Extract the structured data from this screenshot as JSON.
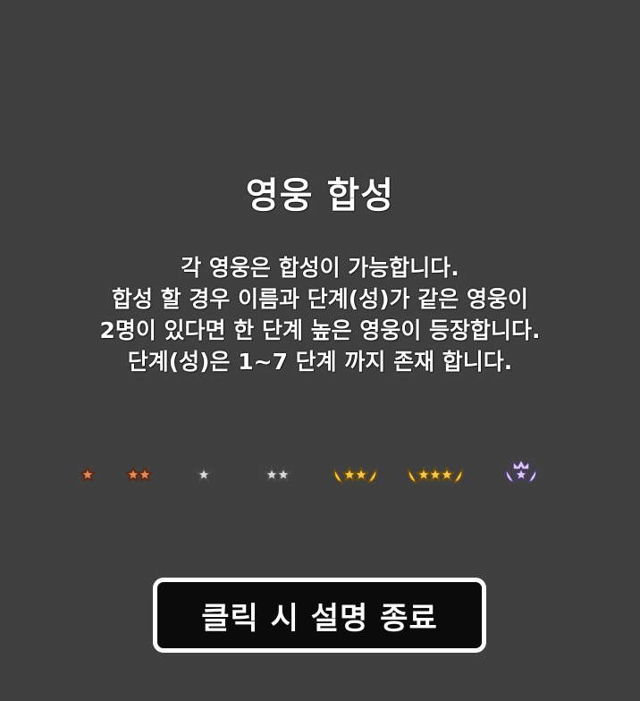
{
  "panel": {
    "title": "영웅 합성",
    "description_lines": [
      "각 영웅은 합성이 가능합니다.",
      "합성 할 경우 이름과 단계(성)가 같은 영웅이",
      "2명이 있다면 한 단계 높은 영웅이 등장합니다.",
      "단계(성)은 1~7 단계 까지 존재 합니다."
    ],
    "close_button_label": "클릭 시 설명 종료"
  },
  "star_tiers": [
    {
      "stars": 1,
      "tier": "bronze",
      "wreath": false,
      "crown": false
    },
    {
      "stars": 2,
      "tier": "bronze",
      "wreath": false,
      "crown": false
    },
    {
      "stars": 1,
      "tier": "silver",
      "wreath": false,
      "crown": false
    },
    {
      "stars": 2,
      "tier": "silver",
      "wreath": false,
      "crown": false
    },
    {
      "stars": 2,
      "tier": "gold",
      "wreath": true,
      "crown": false
    },
    {
      "stars": 3,
      "tier": "gold",
      "wreath": true,
      "crown": false
    },
    {
      "stars": 1,
      "tier": "purple",
      "wreath": true,
      "crown": true
    }
  ],
  "colors": {
    "background": "#404040",
    "text": "#ffffff",
    "button_bg": "#0b0b0b",
    "button_border": "#ffffff",
    "bronze_fill": "#e2895a",
    "bronze_outline": "#5a2a14",
    "silver_fill": "#d8d8d8",
    "silver_outline": "#4a4a4a",
    "gold_fill": "#f3c94a",
    "gold_outline": "#6b4a10",
    "purple_fill": "#d9c8f2",
    "purple_outline": "#4a3a6a"
  }
}
